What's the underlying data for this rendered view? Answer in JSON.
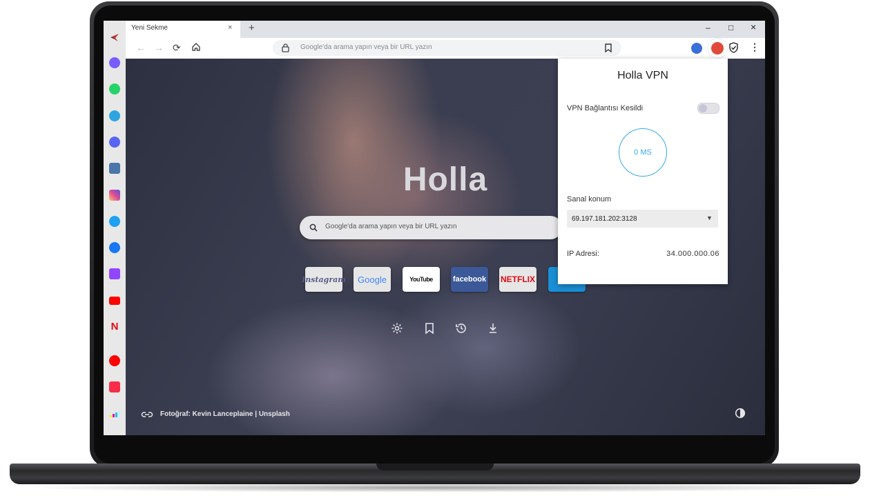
{
  "browser": {
    "tab_title": "Yeni Sekme",
    "tab_close": "×",
    "new_tab": "+",
    "window_controls": {
      "minimize": "–",
      "maximize": "□",
      "close": "×"
    },
    "omnibox_placeholder": "Google'da arama yapın veya bir URL yazın"
  },
  "sidebar": {
    "items": [
      {
        "name": "holla-logo-icon",
        "color": "#c0392b"
      },
      {
        "name": "messenger-icon",
        "color": "#7b5cff"
      },
      {
        "name": "whatsapp-icon",
        "color": "#25d366"
      },
      {
        "name": "telegram-icon",
        "color": "#2ca5e0"
      },
      {
        "name": "discord-icon",
        "color": "#5865f2"
      },
      {
        "name": "vk-icon",
        "color": "#4a76a8"
      },
      {
        "name": "instagram-icon",
        "color": "#d6249f"
      },
      {
        "name": "twitter-icon",
        "color": "#1da1f2"
      },
      {
        "name": "facebook-icon",
        "color": "#1877f2"
      },
      {
        "name": "twitch-icon",
        "color": "#9146ff"
      },
      {
        "name": "youtube-icon",
        "color": "#ff0000"
      },
      {
        "name": "netflix-icon",
        "color": "#e50914"
      },
      {
        "name": "youtube-music-icon",
        "color": "#ff0000"
      },
      {
        "name": "apple-music-icon",
        "color": "#fa2d48"
      },
      {
        "name": "deezer-icon",
        "color": "#00c7f2"
      }
    ]
  },
  "ntp": {
    "logo": "Holla",
    "search_placeholder": "Google'da arama yapın veya bir URL yazın",
    "tiles": [
      {
        "label": "Instagram",
        "bg": "#e6e6e6",
        "color": "#5a5a8a"
      },
      {
        "label": "Google",
        "bg": "#e6e6e6",
        "color": "#4285f4"
      },
      {
        "label": "YouTube",
        "bg": "#ffffff",
        "color": "#111111"
      },
      {
        "label": "facebook",
        "bg": "#3b5998",
        "color": "#ffffff"
      },
      {
        "label": "NETFLIX",
        "bg": "#e6e6e6",
        "color": "#e50914"
      }
    ],
    "credit": "Fotoğraf: Kevin Lanceplaine | Unsplash"
  },
  "vpn_popup": {
    "title": "Holla VPN",
    "status": "VPN Bağlantısı Kesildi",
    "ping": "0 MS",
    "location_label": "Sanal konum",
    "location_value": "69.197.181.202:3128",
    "ip_label": "IP Adresi:",
    "ip_value": "34.000.000.06"
  }
}
